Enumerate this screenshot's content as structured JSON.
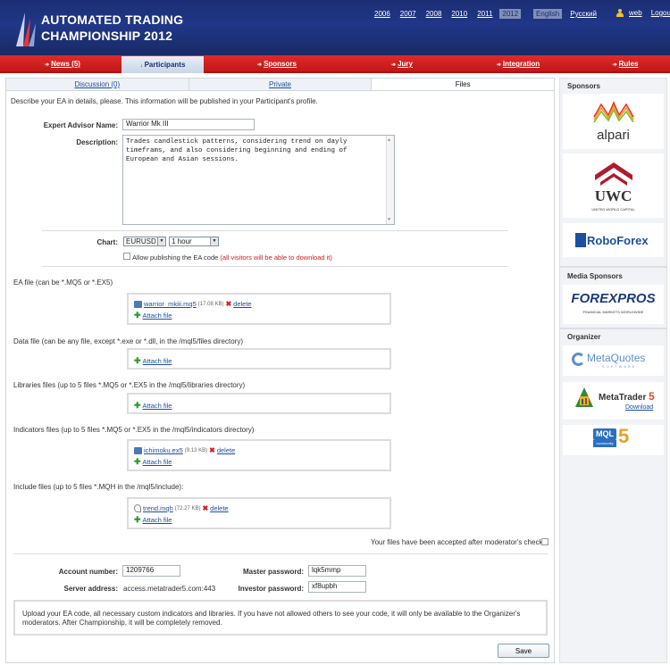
{
  "header": {
    "logo_line1": "AUTOMATED TRADING",
    "logo_line2": "CHAMPIONSHIP 2012",
    "years": [
      "2006",
      "2007",
      "2008",
      "2010",
      "2011",
      "2012"
    ],
    "active_year": "2012",
    "languages": [
      "English",
      "Русский"
    ],
    "active_language": "English",
    "user": "web",
    "logout": "Logout"
  },
  "nav": {
    "items": [
      "News (5)",
      "Participants",
      "Sponsors",
      "Jury",
      "Integration",
      "Rules"
    ],
    "active": "Participants"
  },
  "subtabs": [
    "Discussion (0)",
    "Private",
    "Files"
  ],
  "active_subtab": "Files",
  "form": {
    "intro": "Describe your EA in details, please. This information will be published in your Participant's profile.",
    "ea_name_label": "Expert Advisor Name:",
    "ea_name_value": "Warrior Mk III",
    "description_label": "Description:",
    "description_value": "Trades candlestick patterns, considering trend on dayly\ntimeframs, and also considering beginning and ending of\nEuropean and Asian sessions.",
    "chart_label": "Chart:",
    "symbol": "EURUSD",
    "timeframe": "1 hour",
    "allow_label": "Allow publishing the EA code",
    "allow_note": "(all visitors will be able to download it)"
  },
  "files": {
    "attach_label": "Attach file",
    "delete_label": "delete",
    "sections": [
      {
        "title": "EA file (can be *.MQ5 or *.EX5)",
        "files": [
          {
            "name": "warrior_mkiii.mq5",
            "size": "(17.08 KB)"
          }
        ]
      },
      {
        "title": "Data file (can be any file, except *.exe or *.dll, in the /mql5/files directory)",
        "files": []
      },
      {
        "title": "Libraries files (up to 5 files *.MQ5 or *.EX5 in the /mql5/libraries directory)",
        "files": []
      },
      {
        "title": "Indicators files (up to 5 files *.MQ5 or *.EX5 in the /mql5/indicators directory)",
        "files": [
          {
            "name": "ichimoku.ex5",
            "size": "(9.13 KB)"
          }
        ]
      },
      {
        "title": "Include files (up to 5 files *.MQH in the /mql5/include):",
        "files": [
          {
            "name": "trend.mqh",
            "size": "(72.27 KB)"
          }
        ]
      }
    ],
    "accepted_label": "Your files have been accepted after moderator's check"
  },
  "account": {
    "account_number_label": "Account number:",
    "account_number": "1209766",
    "server_label": "Server address:",
    "server": "access.metatrader5.com:443",
    "master_label": "Master password:",
    "master": "lqk5mmp",
    "investor_label": "Investor password:",
    "investor": "xf8upbh"
  },
  "notice": "Upload your EA code, all necessary custom indicators and libraries. If you have not allowed others to see your code, it will only be available to the Organizer's moderators. After Championship, it will be completely removed.",
  "save_label": "Save",
  "sidebar": {
    "sponsors_title": "Sponsors",
    "alpari": "alpari",
    "uwc": "UWC",
    "uwc_sub": "UNITED WORLD CAPITAL",
    "roboforex": "RoboForex",
    "media_title": "Media Sponsors",
    "forexpros": "FOREXPROS",
    "forexpros_sub": "FINANCIAL MARKETS WORLDWIDE",
    "organizer_title": "Organizer",
    "metaquotes": "MetaQuotes",
    "metaquotes_sub": "SOFTWARE",
    "metatrader": "MetaTrader",
    "metatrader_num": "5",
    "download": "Download",
    "mql": "MQL",
    "mql_num": "5",
    "mql_sub": "community"
  },
  "colors": {
    "header_blue": "#1c2e73",
    "nav_red": "#d82222",
    "link": "#1b4f9c",
    "delete_red": "#cc2020"
  }
}
